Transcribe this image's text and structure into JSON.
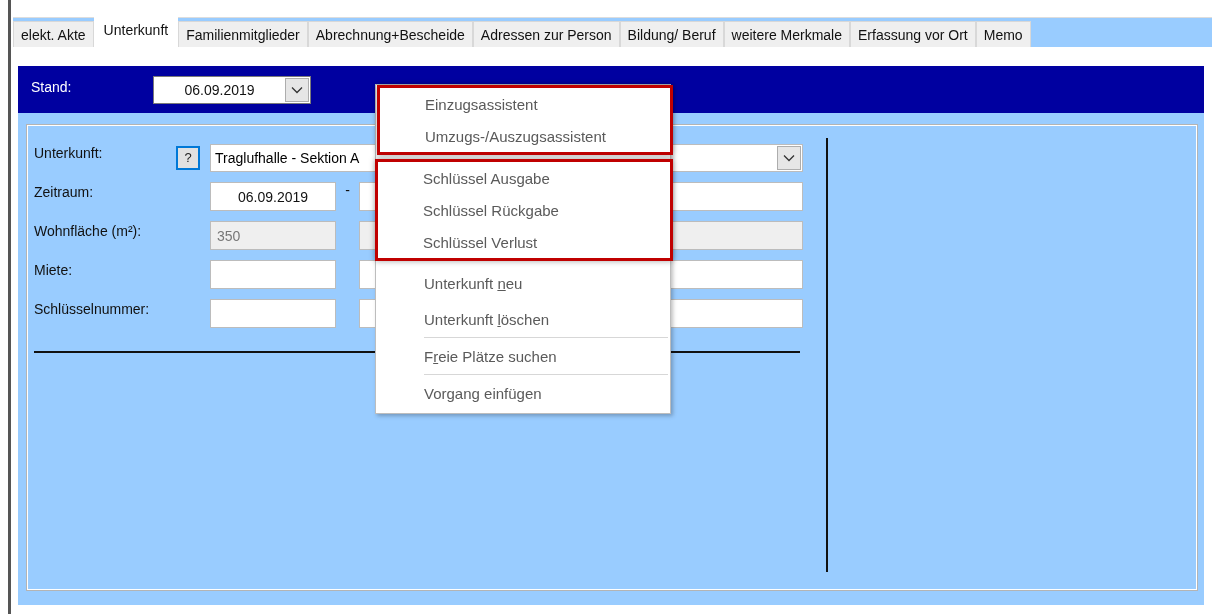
{
  "tabs": [
    {
      "label": "elekt. Akte",
      "selected": false
    },
    {
      "label": "Unterkunft",
      "selected": true
    },
    {
      "label": "Familienmitglieder",
      "selected": false
    },
    {
      "label": "Abrechnung+Bescheide",
      "selected": false
    },
    {
      "label": "Adressen zur Person",
      "selected": false
    },
    {
      "label": "Bildung/ Beruf",
      "selected": false
    },
    {
      "label": "weitere Merkmale",
      "selected": false
    },
    {
      "label": "Erfassung vor Ort",
      "selected": false
    },
    {
      "label": "Memo",
      "selected": false
    }
  ],
  "stand": {
    "label": "Stand:",
    "value": "06.09.2019"
  },
  "form": {
    "rows": [
      {
        "kind": "combo",
        "label": "Unterkunft:",
        "help": "?",
        "value": "Traglufhalle - Sektion A"
      },
      {
        "kind": "range",
        "label": "Zeitraum:",
        "value": "06.09.2019",
        "separator": "-"
      },
      {
        "kind": "readonly",
        "label": "Wohnfläche (m²):",
        "value": "350"
      },
      {
        "kind": "pair",
        "label": "Miete:"
      },
      {
        "kind": "pair",
        "label": "Schlüsselnummer:"
      }
    ]
  },
  "context_menu": {
    "groups": [
      {
        "highlighted": true,
        "separator_before": false,
        "items": [
          {
            "label_parts": [
              "Einzugsassistent"
            ]
          },
          {
            "label_parts": [
              "Umzugs-/Auszugsassistent"
            ]
          }
        ]
      },
      {
        "highlighted": true,
        "separator_before": false,
        "items": [
          {
            "label_parts": [
              "Schlüssel Ausgabe"
            ]
          },
          {
            "label_parts": [
              "Schlüssel Rückgabe"
            ]
          },
          {
            "label_parts": [
              "Schlüssel Verlust"
            ]
          }
        ]
      },
      {
        "highlighted": false,
        "separator_before": false,
        "items": [
          {
            "label_parts": [
              "Unterkunft ",
              "n",
              "eu"
            ]
          },
          {
            "label_parts": [
              "Unterkunft ",
              "l",
              "öschen"
            ]
          }
        ]
      },
      {
        "highlighted": false,
        "separator_before": true,
        "items": [
          {
            "label_parts": [
              "F",
              "r",
              "eie Plätze suchen"
            ]
          }
        ]
      },
      {
        "highlighted": false,
        "separator_before": true,
        "items": [
          {
            "label_parts": [
              "Vorgang einfügen"
            ]
          }
        ]
      }
    ]
  }
}
